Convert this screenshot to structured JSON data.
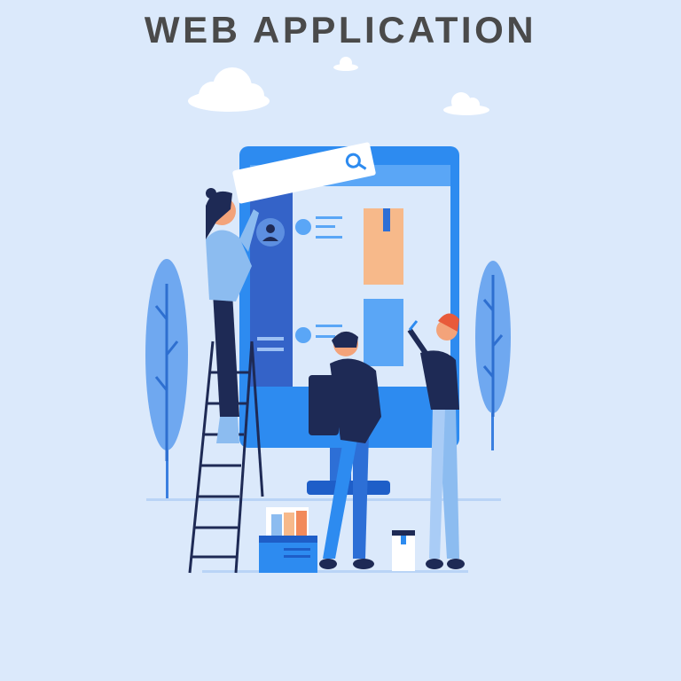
{
  "title": "WEB APPLICATION",
  "icons": [
    "search-icon",
    "user-icon",
    "cloud-icon",
    "tree-icon",
    "paint-bucket-icon"
  ],
  "colors": {
    "background": "#dbe9fb",
    "title": "#4a4a4a",
    "primary_blue": "#2d8bf0",
    "navy": "#1e2a55",
    "light_blue": "#8cbcf0",
    "peach": "#f7b98a"
  }
}
